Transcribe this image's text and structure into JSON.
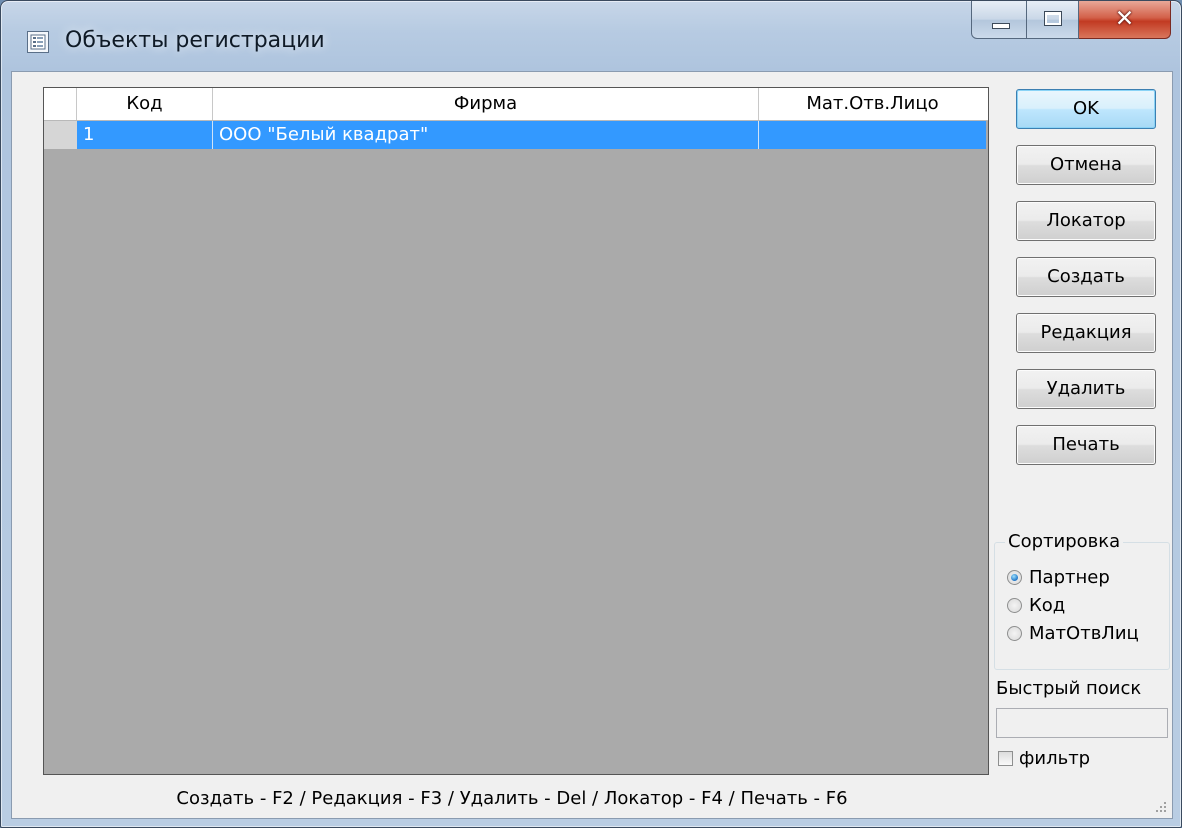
{
  "window": {
    "title": "Объекты регистрации"
  },
  "grid": {
    "columns": [
      "Код",
      "Фирма",
      "Мат.Отв.Лицо"
    ],
    "rows": [
      {
        "code": "1",
        "firm": "ООО \"Белый квадрат\"",
        "mat": ""
      }
    ],
    "selected_row": 0
  },
  "buttons": {
    "ok": "OK",
    "cancel": "Отмена",
    "locator": "Локатор",
    "create": "Создать",
    "edit": "Редакция",
    "delete": "Удалить",
    "print": "Печать"
  },
  "sort": {
    "title": "Сортировка",
    "options": [
      "Партнер",
      "Код",
      "МатОтвЛиц"
    ],
    "selected": "Партнер"
  },
  "quick_search": {
    "label": "Быстрый поиск",
    "value": "",
    "filter_label": "фильтр",
    "filter_checked": false
  },
  "status_bar": {
    "hotkeys": "Создать - F2 / Редакция - F3 / Удалить - Del / Локатор - F4 / Печать - F6"
  },
  "colors": {
    "selection": "#3399ff",
    "grid_background": "#aaaaaa",
    "close_button": "#c23a22"
  }
}
